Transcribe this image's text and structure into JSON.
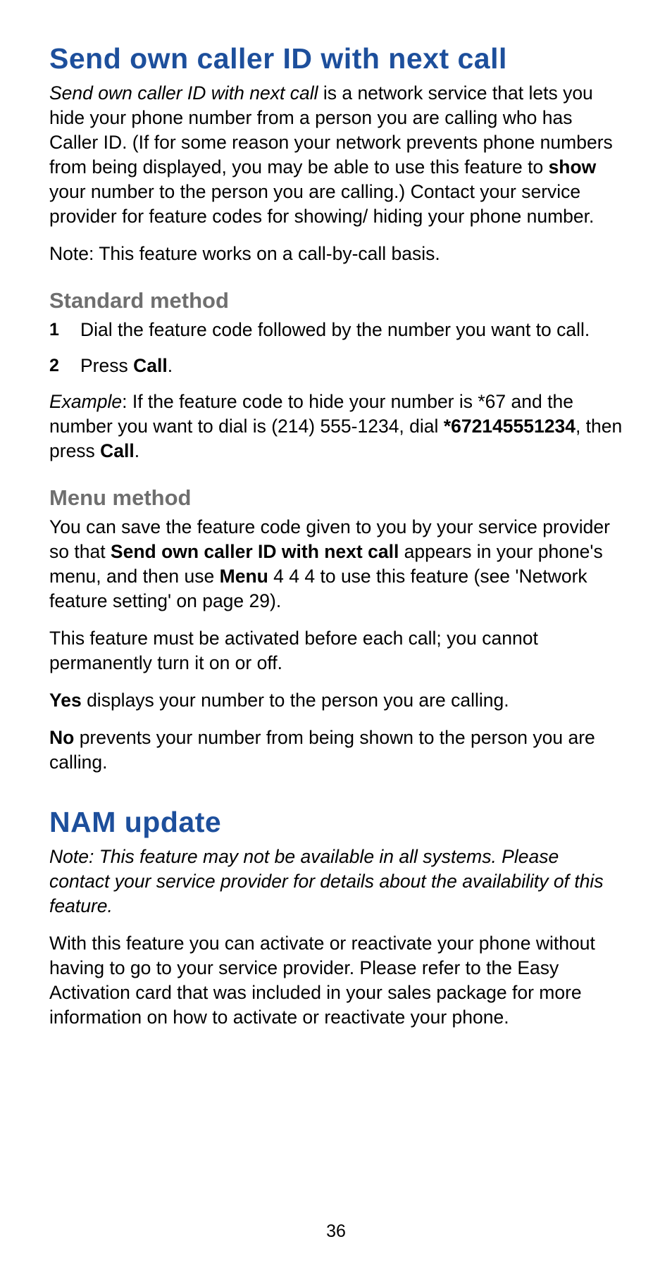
{
  "section1": {
    "title": "Send own caller ID with next call",
    "intro_lead": "Send own caller ID with next call",
    "intro_mid1": " is a network service that lets you hide your phone number from a person you are calling who has Caller ID. (If for some reason your network prevents phone numbers from being displayed, you may be able to use this feature to ",
    "intro_show": "show",
    "intro_mid2": " your number to the person you are calling.) Contact your service provider for feature codes for showing/ hiding your phone number.",
    "note": "Note: This feature works on a call-by-call basis.",
    "standard_heading": "Standard method",
    "step1_num": "1",
    "step1_text": "Dial the feature code followed by the number you want to call.",
    "step2_num": "2",
    "step2_pre": "Press ",
    "step2_call": "Call",
    "step2_post": ".",
    "example_label": "Example",
    "example_mid1": ":  If the feature code to hide your number is *67 and the number you want to dial is (214) 555-1234, dial ",
    "example_dial": "*672145551234",
    "example_mid2": ", then press ",
    "example_call": "Call",
    "example_post": ".",
    "menu_heading": "Menu method",
    "menu_p1_pre": "You can save the feature code given to you by your service provider so that ",
    "menu_p1_bold1": "Send own caller ID with next call",
    "menu_p1_mid": " appears in your phone's menu, and then use ",
    "menu_p1_bold2": "Menu",
    "menu_p1_post": " 4 4 4 to use this feature (see 'Network feature setting' on page 29).",
    "menu_p2": "This feature must be activated before each call; you cannot permanently turn it on or off.",
    "yes_label": "Yes",
    "yes_text": " displays your number to the person you are calling.",
    "no_label": "No",
    "no_text": " prevents your number from being shown to the person you are calling."
  },
  "section2": {
    "title": "NAM update",
    "note": "Note:  This feature may not be available in all systems. Please contact your service provider for details about the availability of this feature.",
    "body": "With this feature you can activate or reactivate your phone without having to go to your service provider. Please refer to the Easy Activation card that was included in your sales package for more information on how to activate or reactivate your phone."
  },
  "page_number": "36"
}
